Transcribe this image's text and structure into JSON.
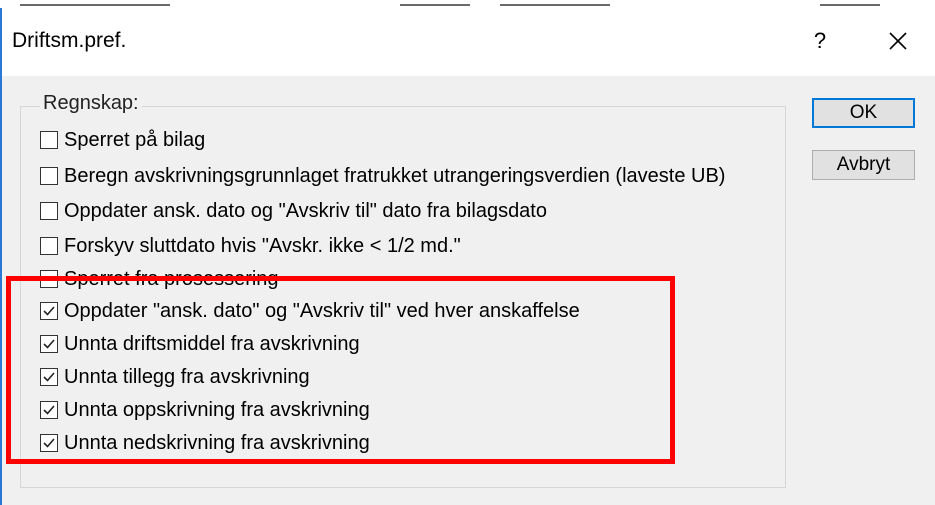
{
  "dialog": {
    "title": "Driftsm.pref.",
    "help_label": "?",
    "close_icon": "close-icon"
  },
  "group": {
    "label": "Regnskap:"
  },
  "checkboxes": [
    {
      "label": "Sperret på bilag",
      "checked": false
    },
    {
      "label": "Beregn avskrivningsgrunnlaget fratrukket utrangeringsverdien (laveste UB)",
      "checked": false
    },
    {
      "label": "Oppdater ansk. dato og \"Avskriv til\" dato fra bilagsdato",
      "checked": false
    },
    {
      "label": "Forskyv sluttdato hvis \"Avskr. ikke < 1/2 md.\"",
      "checked": false
    },
    {
      "label": "Sperret fra prosessering",
      "checked": false
    },
    {
      "label": "Oppdater \"ansk. dato\" og \"Avskriv til\" ved hver anskaffelse",
      "checked": true
    },
    {
      "label": "Unnta driftsmiddel fra avskrivning",
      "checked": true
    },
    {
      "label": "Unnta tillegg fra avskrivning",
      "checked": true
    },
    {
      "label": "Unnta oppskrivning fra avskrivning",
      "checked": true
    },
    {
      "label": "Unnta nedskrivning fra avskrivning",
      "checked": true
    }
  ],
  "buttons": {
    "ok_label": "OK",
    "cancel_label": "Avbryt"
  },
  "colors": {
    "highlight": "#ff0000",
    "accent": "#0078d7",
    "dialog_bg": "#f0f0f0"
  }
}
